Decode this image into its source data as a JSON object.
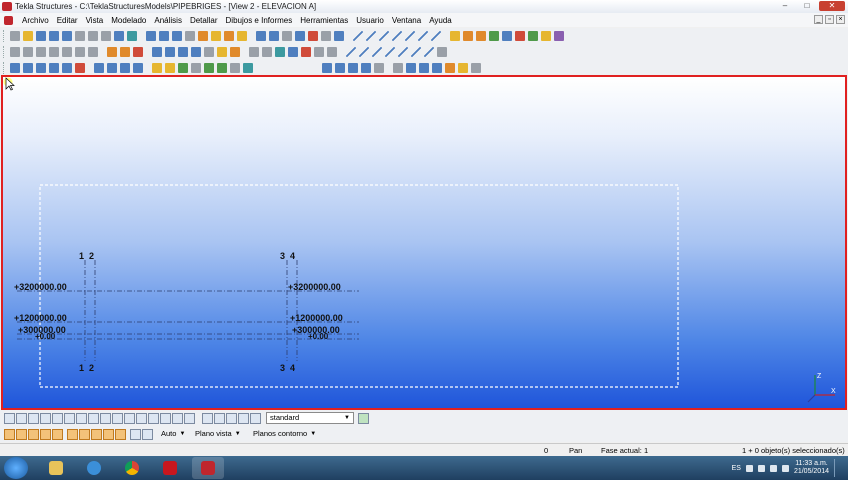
{
  "window": {
    "title": "Tekla Structures - C:\\TeklaStructuresModels\\PIPEBRIGES - [View 2 - ELEVACION A]",
    "minimize": "–",
    "maximize": "□",
    "close": "✕"
  },
  "menu": [
    "Archivo",
    "Editar",
    "Vista",
    "Modelado",
    "Análisis",
    "Detallar",
    "Dibujos e Informes",
    "Herramientas",
    "Usuario",
    "Ventana",
    "Ayuda"
  ],
  "view": {
    "grid_labels_top": [
      "1",
      "2",
      "3",
      "4"
    ],
    "grid_labels_bottom": [
      "1",
      "2",
      "3",
      "4"
    ],
    "level_labels": [
      "+3200000.00",
      "+1200000.00",
      "+300000.00"
    ],
    "level_overlap_label": "+0.00",
    "axis": {
      "z": "Z",
      "x": "X"
    }
  },
  "bottom_toolbar": {
    "select_filter": "standard",
    "snap_mode": "Auto",
    "plane": "Plano vista",
    "depth": "Planos contorno"
  },
  "status": {
    "count": "0",
    "command": "Pan",
    "phase": "Fase actual: 1",
    "selection": "1 + 0 objeto(s) seleccionado(s)"
  },
  "taskbar": {
    "language": "ES",
    "time": "11:33 a.m.",
    "date": "21/05/2014"
  }
}
